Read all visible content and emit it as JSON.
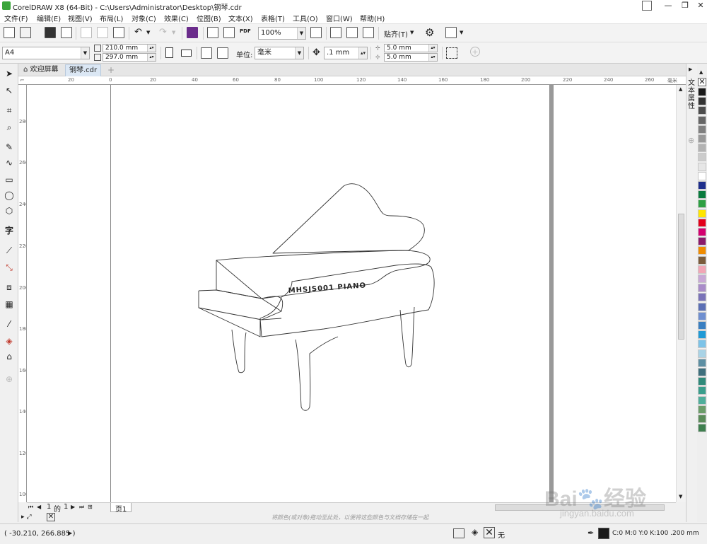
{
  "window": {
    "title": "CorelDRAW X8 (64-Bit) - C:\\Users\\Administrator\\Desktop\\钢琴.cdr",
    "controls": [
      "—",
      "❐",
      "✕"
    ]
  },
  "menu": [
    "文件(F)",
    "编辑(E)",
    "视图(V)",
    "布局(L)",
    "对象(C)",
    "效果(C)",
    "位图(B)",
    "文本(X)",
    "表格(T)",
    "工具(O)",
    "窗口(W)",
    "帮助(H)"
  ],
  "toolbar": {
    "pdf_label": "PDF",
    "zoom": "100%",
    "snap_label": "贴齐(T)"
  },
  "properties": {
    "paper_size": "A4",
    "width": "210.0 mm",
    "height": "297.0 mm",
    "units_label": "单位:",
    "units_value": "毫米",
    "nudge": ".1 mm",
    "dup_x": "5.0 mm",
    "dup_y": "5.0 mm"
  },
  "tabs": [
    {
      "label": "欢迎屏幕"
    },
    {
      "label": "钢琴.cdr"
    }
  ],
  "ruler": {
    "h_labels": [
      "20",
      "0",
      "20",
      "40",
      "60",
      "80",
      "100",
      "120",
      "140",
      "160",
      "180",
      "200",
      "220",
      "240",
      "260"
    ],
    "h_unit": "毫米",
    "v_labels": [
      "280",
      "260",
      "240",
      "220",
      "200",
      "180",
      "160",
      "140",
      "120",
      "100"
    ]
  },
  "artwork": {
    "piano_label": "MHSJS001 PIANO"
  },
  "page_nav": {
    "current": "1",
    "of": "的",
    "total": "1",
    "page_tab": "页1"
  },
  "hint": "将颜色(或对象)拖动至此处，以便将这些颜色与文档存储在一起",
  "docker": {
    "panel_title": "文本属性"
  },
  "palette_colors": [
    "#1a1a1a",
    "#333333",
    "#4d4d4d",
    "#666666",
    "#808080",
    "#999999",
    "#b3b3b3",
    "#cccccc",
    "#e6e6e6",
    "#ffffff",
    "#1f2f8c",
    "#0a7b3e",
    "#2ea043",
    "#ffe600",
    "#e3001b",
    "#d4006f",
    "#8b1a6b",
    "#f08c00",
    "#7a5c3c",
    "#f2a6b6",
    "#c9a8d6",
    "#a98cc9",
    "#7a73b8",
    "#5b6fb5",
    "#6f8fd0",
    "#3a7fc1",
    "#1f9ad6",
    "#7cc3e8",
    "#a9d3e6",
    "#5d8fa3",
    "#3e6f7d",
    "#2f8a7a",
    "#3a9e8c",
    "#4fae9b",
    "#6c9d6a",
    "#5b8c5a",
    "#3f7f4f"
  ],
  "status": {
    "coordinates": "( -30.210, 266.885 )",
    "fill_label": "无",
    "outline_info": "C:0 M:0 Y:0 K:100  .200 mm"
  },
  "watermark": {
    "brand": "Bai",
    "brand_cn": "经验",
    "url": "jingyan.baidu.com"
  }
}
